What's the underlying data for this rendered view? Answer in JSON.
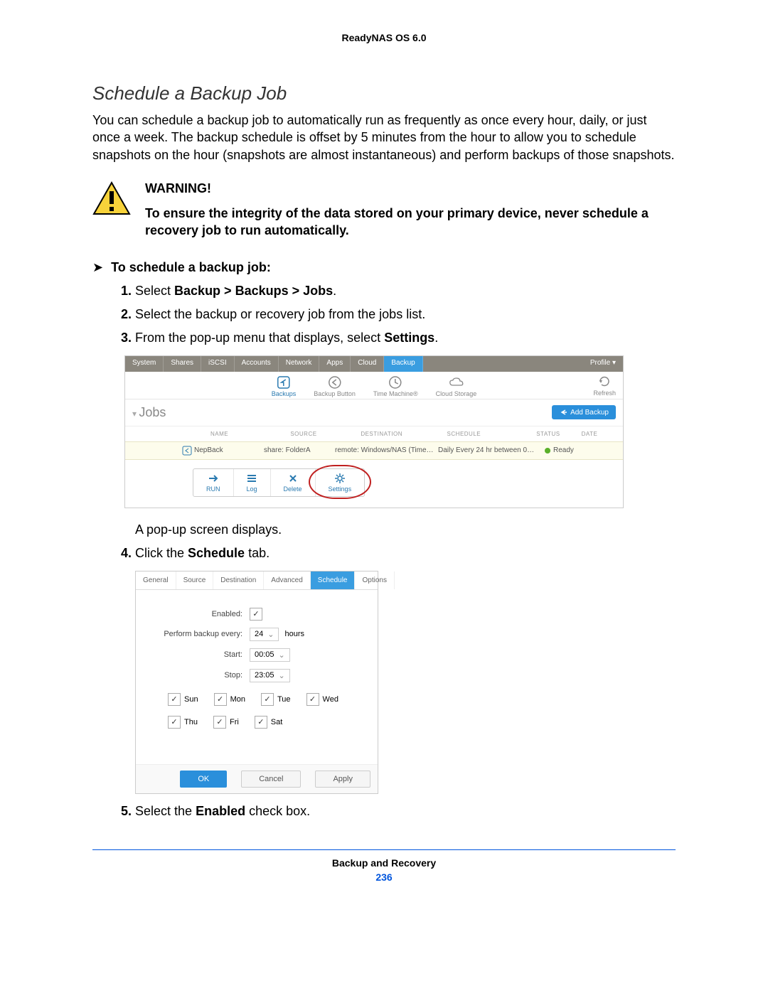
{
  "doc_header": "ReadyNAS OS 6.0",
  "section_title": "Schedule a Backup Job",
  "intro": "You can schedule a backup job to automatically run as frequently as once every hour, daily, or just once a week. The backup schedule is offset by 5 minutes from the hour to allow you to schedule snapshots on the hour (snapshots are almost instantaneous) and perform backups of those snapshots.",
  "warning": {
    "title": "WARNING!",
    "body": "To ensure the integrity of the data stored on your primary device, never schedule a recovery job to run automatically."
  },
  "procedure_heading": "To schedule a backup job:",
  "steps": {
    "s1_pre": "Select ",
    "s1_bold": "Backup > Backups > Jobs",
    "s1_post": ".",
    "s2": "Select the backup or recovery job from the jobs list.",
    "s3_pre": "From the pop-up menu that displays, select ",
    "s3_bold": "Settings",
    "s3_post": ".",
    "s4_pre": "Click the ",
    "s4_bold": "Schedule",
    "s4_post": " tab.",
    "s5_pre": "Select the ",
    "s5_bold": "Enabled",
    "s5_post": " check box."
  },
  "popup_note": "A pop-up screen displays.",
  "shot1": {
    "nav": [
      "System",
      "Shares",
      "iSCSI",
      "Accounts",
      "Network",
      "Apps",
      "Cloud",
      "Backup"
    ],
    "nav_active": "Backup",
    "profile": "Profile ▾",
    "subnav": {
      "backups": "Backups",
      "backup_button": "Backup Button",
      "time_machine": "Time Machine®",
      "cloud_storage": "Cloud Storage",
      "refresh": "Refresh"
    },
    "jobs_label": "Jobs",
    "add_backup": "Add Backup",
    "cols": {
      "name": "NAME",
      "source": "SOURCE",
      "dest": "DESTINATION",
      "sched": "SCHEDULE",
      "status": "STATUS",
      "date": "DATE"
    },
    "row": {
      "name": "NepBack",
      "source": "share: FolderA",
      "dest": "remote: Windows/NAS (Time…",
      "sched": "Daily Every 24 hr between 0…",
      "status": "Ready"
    },
    "popup": {
      "run": "RUN",
      "log": "Log",
      "delete": "Delete",
      "settings": "Settings"
    }
  },
  "shot2": {
    "tabs": [
      "General",
      "Source",
      "Destination",
      "Advanced",
      "Schedule",
      "Options"
    ],
    "tab_active": "Schedule",
    "labels": {
      "enabled": "Enabled:",
      "every": "Perform backup every:",
      "hours": "hours",
      "start": "Start:",
      "stop": "Stop:"
    },
    "values": {
      "every": "24",
      "start": "00:05",
      "stop": "23:05"
    },
    "days": [
      "Sun",
      "Mon",
      "Tue",
      "Wed",
      "Thu",
      "Fri",
      "Sat"
    ],
    "buttons": {
      "ok": "OK",
      "cancel": "Cancel",
      "apply": "Apply"
    }
  },
  "footer": {
    "chapter": "Backup and Recovery",
    "page": "236"
  }
}
